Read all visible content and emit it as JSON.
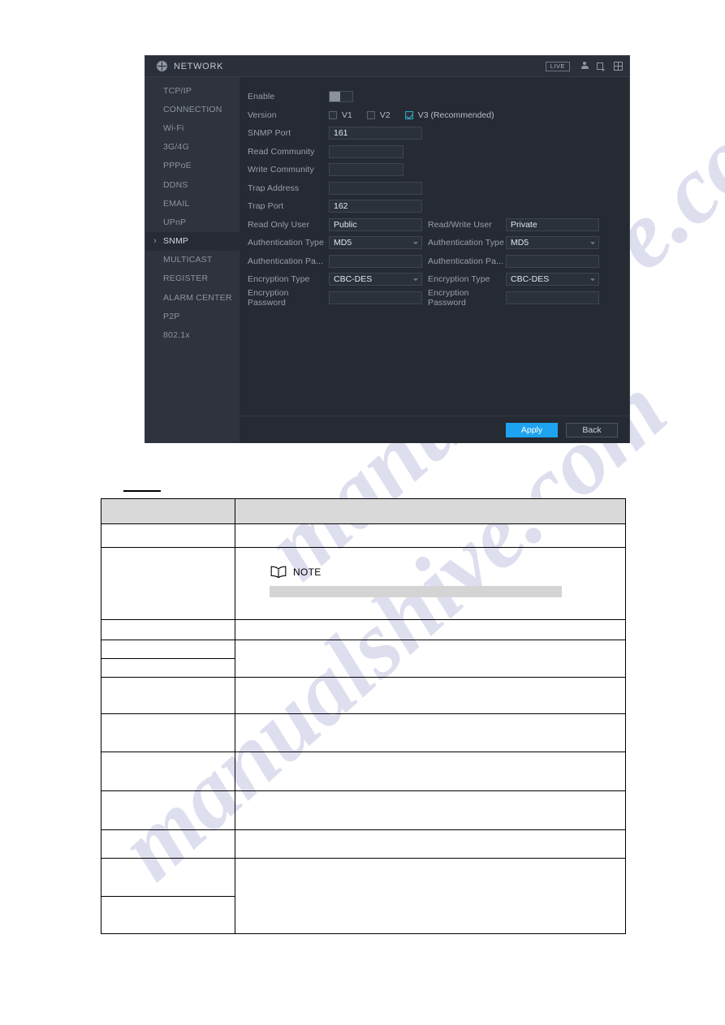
{
  "window": {
    "title": "NETWORK",
    "title_icon": "network-globe-icon",
    "live_badge": "LIVE",
    "toolbar_icons": [
      "user-icon",
      "exit-icon",
      "grid-layout-icon"
    ]
  },
  "sidebar": {
    "items": [
      {
        "label": "TCP/IP",
        "active": false
      },
      {
        "label": "CONNECTION",
        "active": false
      },
      {
        "label": "Wi-Fi",
        "active": false
      },
      {
        "label": "3G/4G",
        "active": false
      },
      {
        "label": "PPPoE",
        "active": false
      },
      {
        "label": "DDNS",
        "active": false
      },
      {
        "label": "EMAIL",
        "active": false
      },
      {
        "label": "UPnP",
        "active": false
      },
      {
        "label": "SNMP",
        "active": true
      },
      {
        "label": "MULTICAST",
        "active": false
      },
      {
        "label": "REGISTER",
        "active": false
      },
      {
        "label": "ALARM CENTER",
        "active": false
      },
      {
        "label": "P2P",
        "active": false
      },
      {
        "label": "802.1x",
        "active": false
      }
    ]
  },
  "form": {
    "enable": {
      "label": "Enable",
      "state": "off"
    },
    "version": {
      "label": "Version",
      "options": [
        {
          "label": "V1",
          "checked": false
        },
        {
          "label": "V2",
          "checked": false
        },
        {
          "label": "V3 (Recommended)",
          "checked": true
        }
      ]
    },
    "snmp_port": {
      "label": "SNMP Port",
      "value": "161"
    },
    "read_community": {
      "label": "Read Community",
      "value": ""
    },
    "write_community": {
      "label": "Write Community",
      "value": ""
    },
    "trap_address": {
      "label": "Trap Address",
      "value": ""
    },
    "trap_port": {
      "label": "Trap Port",
      "value": "162"
    },
    "read_only_user": {
      "label": "Read Only User",
      "value": "Public"
    },
    "read_write_user": {
      "label": "Read/Write User",
      "value": "Private"
    },
    "auth_type_left": {
      "label": "Authentication Type",
      "value": "MD5"
    },
    "auth_type_right": {
      "label": "Authentication Type",
      "value": "MD5"
    },
    "auth_password_left": {
      "label": "Authentication Pa...",
      "value": ""
    },
    "auth_password_right": {
      "label": "Authentication Pa...",
      "value": ""
    },
    "encryption_type_left": {
      "label": "Encryption Type",
      "value": "CBC-DES"
    },
    "encryption_type_right": {
      "label": "Encryption Type",
      "value": "CBC-DES"
    },
    "encryption_password_left": {
      "label": "Encryption Password",
      "value": ""
    },
    "encryption_password_right": {
      "label": "Encryption Password",
      "value": ""
    }
  },
  "footer": {
    "apply_label": "Apply",
    "back_label": "Back",
    "apply_color": "#1da3f0"
  },
  "document": {
    "watermark_line_1": "manualshive.com",
    "watermark_line_2": "manualshive.com",
    "table": {
      "header": [
        "",
        ""
      ],
      "rows": [
        {
          "col1": "",
          "col2": ""
        },
        {
          "col1": "",
          "col2": "",
          "note": {
            "icon": "book-icon",
            "label": "NOTE",
            "redacted_bar": true
          }
        },
        {
          "col1": "",
          "col2": ""
        },
        {
          "col1": "",
          "col2": ""
        },
        {
          "col1": "",
          "col2": ""
        },
        {
          "col1": "",
          "col2": ""
        },
        {
          "col1": "",
          "col2": ""
        },
        {
          "col1": "",
          "col2": ""
        },
        {
          "col1": "",
          "col2": ""
        },
        {
          "col1": "",
          "col2": ""
        },
        {
          "col1": "",
          "col2": ""
        },
        {
          "col1": "",
          "col2": ""
        }
      ]
    }
  }
}
